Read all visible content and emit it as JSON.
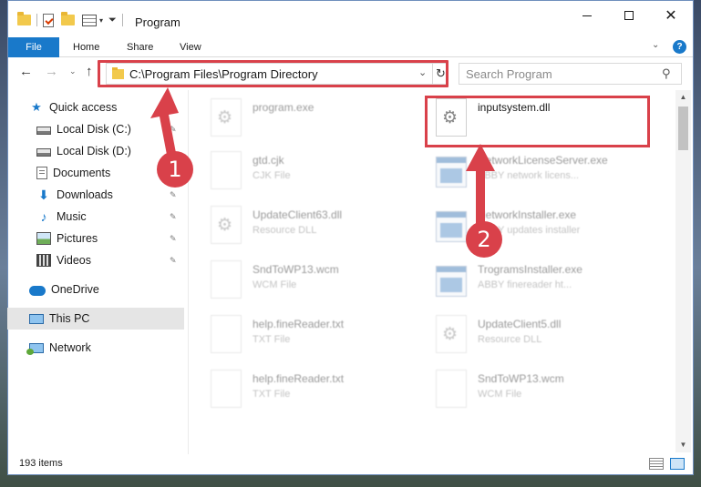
{
  "window": {
    "title": "Program"
  },
  "ribbon": {
    "tabs": [
      {
        "label": "File"
      },
      {
        "label": "Home"
      },
      {
        "label": "Share"
      },
      {
        "label": "View"
      }
    ],
    "help_symbol": "?"
  },
  "titlebar": {
    "minimize_symbol": "",
    "close_symbol": "✕"
  },
  "address": {
    "path": "C:\\Program Files\\Program Directory",
    "dropdown_symbol": "⌄",
    "refresh_symbol": "↻"
  },
  "search": {
    "placeholder": "Search Program"
  },
  "nav": {
    "back": "←",
    "forward": "→",
    "recent": "⌄",
    "up": "↑"
  },
  "sidebar": {
    "items": [
      {
        "label": "Quick access",
        "icon": "star-icon"
      },
      {
        "label": "Local Disk (C:)",
        "icon": "disk-icon"
      },
      {
        "label": "Local Disk (D:)",
        "icon": "disk-icon"
      },
      {
        "label": "Documents",
        "icon": "documents-icon"
      },
      {
        "label": "Downloads",
        "icon": "downloads-icon"
      },
      {
        "label": "Music",
        "icon": "music-icon"
      },
      {
        "label": "Pictures",
        "icon": "pictures-icon"
      },
      {
        "label": "Videos",
        "icon": "videos-icon"
      },
      {
        "label": "OneDrive",
        "icon": "cloud-icon"
      },
      {
        "label": "This PC",
        "icon": "computer-icon"
      },
      {
        "label": "Network",
        "icon": "network-icon"
      }
    ],
    "pin_symbol": "📌"
  },
  "files": {
    "items": [
      {
        "name": "program.exe",
        "type": ""
      },
      {
        "name": "inputsystem.dll",
        "type": ""
      },
      {
        "name": "gtd.cjk",
        "type": "CJK File"
      },
      {
        "name": "NetworkLicenseServer.exe",
        "type": "ABBY network licens..."
      },
      {
        "name": "UpdateClient63.dll",
        "type": "Resource DLL"
      },
      {
        "name": "NetworkInstaller.exe",
        "type": "ABBY updates installer"
      },
      {
        "name": "SndToWP13.wcm",
        "type": "WCM File"
      },
      {
        "name": "TrogramsInstaller.exe",
        "type": "ABBY finereader ht..."
      },
      {
        "name": "help.fineReader.txt",
        "type": "TXT File"
      },
      {
        "name": "UpdateClient5.dll",
        "type": "Resource DLL"
      },
      {
        "name": "help.fineReader.txt",
        "type": "TXT File"
      },
      {
        "name": "SndToWP13.wcm",
        "type": "WCM File"
      }
    ]
  },
  "annotations": {
    "step1": "1",
    "step2": "2",
    "color": "#d9414a"
  },
  "status": {
    "item_count": "193 items"
  },
  "colors": {
    "accent": "#1979ca",
    "highlight": "#d9414a"
  }
}
